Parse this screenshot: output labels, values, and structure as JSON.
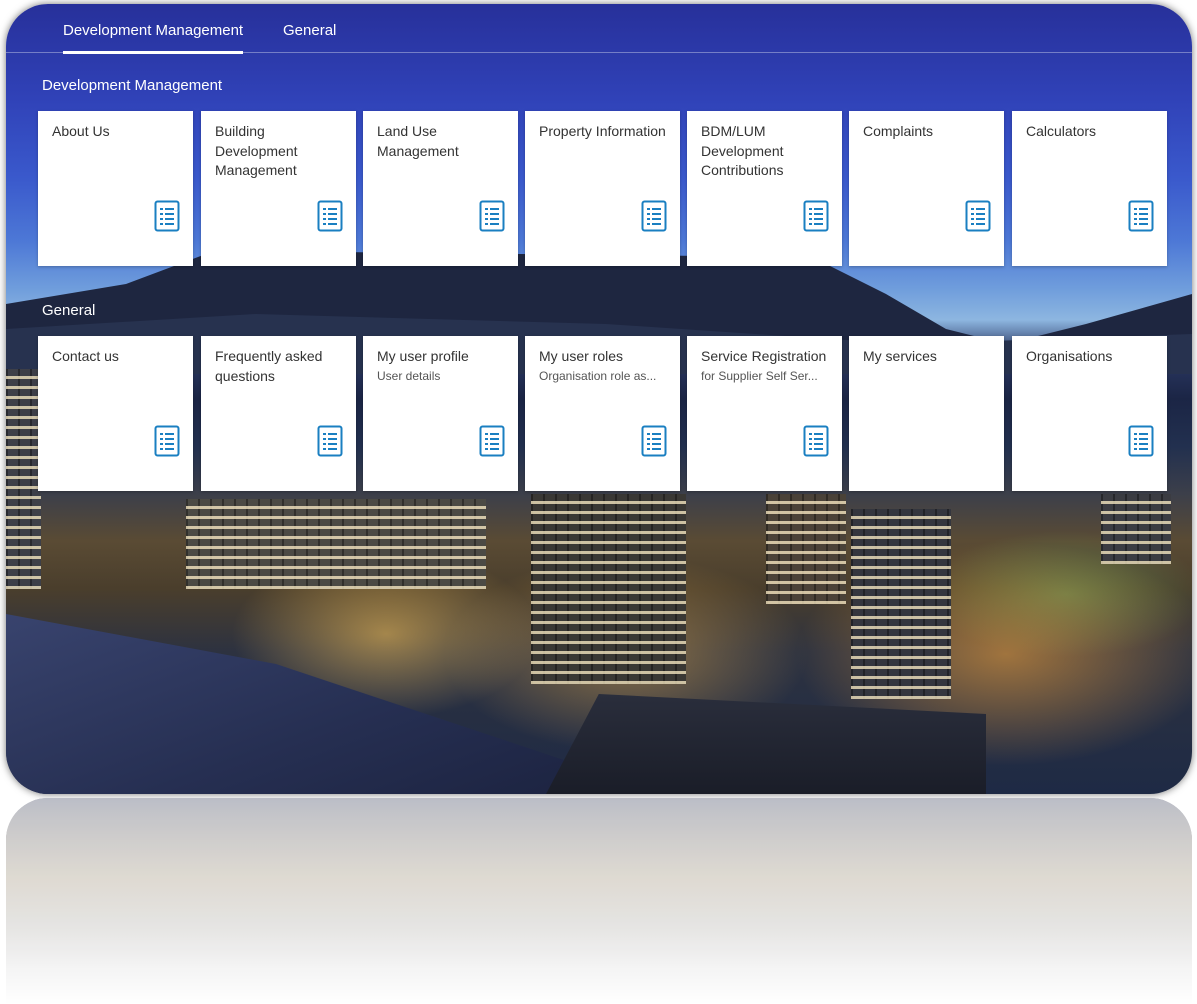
{
  "tabs": [
    {
      "label": "Development Management",
      "active": true
    },
    {
      "label": "General",
      "active": false
    }
  ],
  "sections": [
    {
      "title": "Development Management",
      "tiles": [
        {
          "title": "About Us",
          "subtitle": "",
          "icon": "list-icon"
        },
        {
          "title": "Building Development Management",
          "subtitle": "",
          "icon": "list-icon"
        },
        {
          "title": "Land Use Management",
          "subtitle": "",
          "icon": "list-icon"
        },
        {
          "title": "Property Information",
          "subtitle": "",
          "icon": "list-icon"
        },
        {
          "title": "BDM/LUM Development Contributions",
          "subtitle": "",
          "icon": "list-icon"
        },
        {
          "title": "Complaints",
          "subtitle": "",
          "icon": "list-icon"
        },
        {
          "title": "Calculators",
          "subtitle": "",
          "icon": "list-icon"
        }
      ]
    },
    {
      "title": "General",
      "tiles": [
        {
          "title": "Contact us",
          "subtitle": "",
          "icon": "list-icon"
        },
        {
          "title": "Frequently asked questions",
          "subtitle": "",
          "icon": "list-icon"
        },
        {
          "title": "My user profile",
          "subtitle": "User details",
          "icon": "list-icon"
        },
        {
          "title": "My user roles",
          "subtitle": "Organisation role as...",
          "icon": "list-icon"
        },
        {
          "title": "Service Registration",
          "subtitle": "for Supplier Self Ser...",
          "icon": "list-icon"
        },
        {
          "title": "My services",
          "subtitle": "",
          "icon": ""
        },
        {
          "title": "Organisations",
          "subtitle": "",
          "icon": "list-icon"
        }
      ]
    }
  ],
  "colors": {
    "icon": "#1a7fc1",
    "tile_bg": "#ffffff",
    "text": "#333333"
  }
}
